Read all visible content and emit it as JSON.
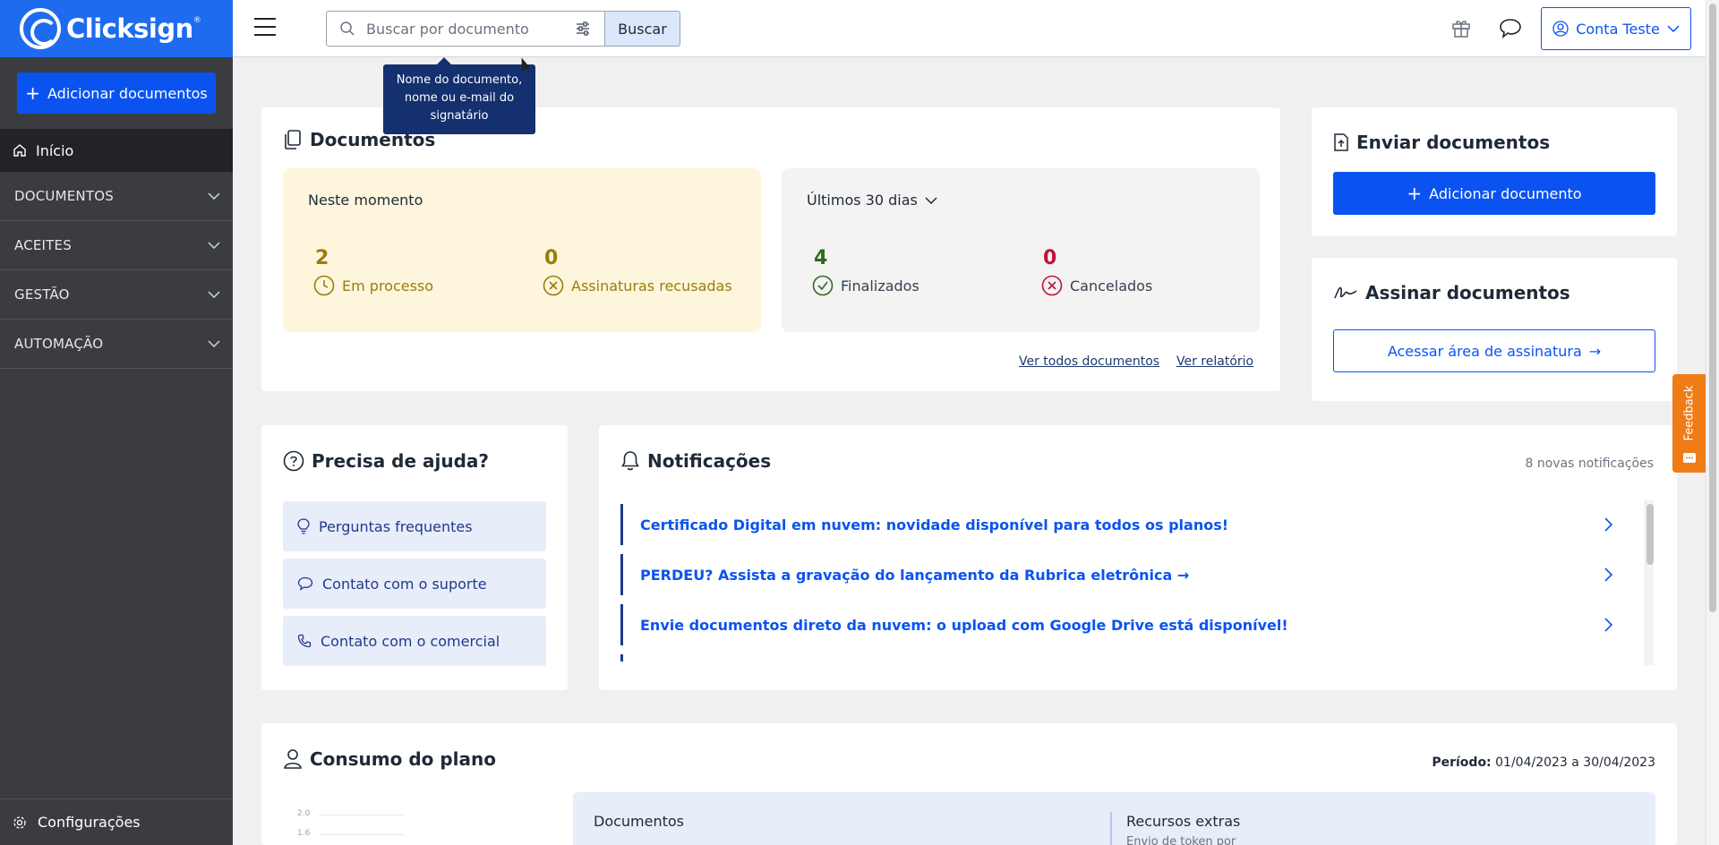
{
  "brand": {
    "name": "Clicksign",
    "trademark": "®"
  },
  "sidebar": {
    "add_button": "Adicionar documentos",
    "home": "Início",
    "sections": [
      {
        "label": "DOCUMENTOS"
      },
      {
        "label": "ACEITES"
      },
      {
        "label": "GESTÃO"
      },
      {
        "label": "AUTOMAÇÃO"
      }
    ],
    "footer": "Configurações"
  },
  "topbar": {
    "search_placeholder": "Buscar por documento",
    "search_button": "Buscar",
    "account": "Conta Teste"
  },
  "tooltip": {
    "text": "Nome do documento, nome ou e-mail do signatário"
  },
  "documents": {
    "title": "Documentos",
    "now_label": "Neste momento",
    "in_process": {
      "value": "2",
      "label": "Em processo"
    },
    "refused": {
      "value": "0",
      "label": "Assinaturas recusadas"
    },
    "period_label": "Últimos 30 dias",
    "finished": {
      "value": "4",
      "label": "Finalizados"
    },
    "cancelled": {
      "value": "0",
      "label": "Cancelados"
    },
    "link_all": "Ver todos documentos",
    "link_report": "Ver relatório"
  },
  "send": {
    "title": "Enviar documentos",
    "button": "Adicionar documento"
  },
  "sign": {
    "title": "Assinar documentos",
    "button": "Acessar área de assinatura"
  },
  "help": {
    "title": "Precisa de ajuda?",
    "items": [
      {
        "label": "Perguntas frequentes"
      },
      {
        "label": "Contato com o suporte"
      },
      {
        "label": "Contato com o comercial"
      }
    ]
  },
  "notifications": {
    "title": "Notificações",
    "count": "8 novas notificações",
    "items": [
      {
        "text": "Certificado Digital em nuvem: novidade disponível para todos os planos!"
      },
      {
        "text": "PERDEU? Assista a gravação do lançamento da Rubrica eletrônica →"
      },
      {
        "text": "Envie documentos direto da nuvem: o upload com Google Drive está disponível!"
      }
    ]
  },
  "plan": {
    "title": "Consumo do plano",
    "period_label": "Período:",
    "period_value": "01/04/2023 a 30/04/2023",
    "axis_ticks": [
      "2.0",
      "1.6"
    ],
    "docs_label": "Documentos",
    "extras_label": "Recursos extras",
    "extras_sub": "Envio de token por"
  },
  "feedback": {
    "label": "Feedback"
  },
  "colors": {
    "brand_blue": "#0b53f0",
    "sidebar_bg": "#3a3c40",
    "warning_bg": "#fdf6dc",
    "warning_text": "#9a7d0a",
    "success": "#2e6b1f",
    "danger": "#c0143c",
    "feedback": "#f07c17"
  }
}
